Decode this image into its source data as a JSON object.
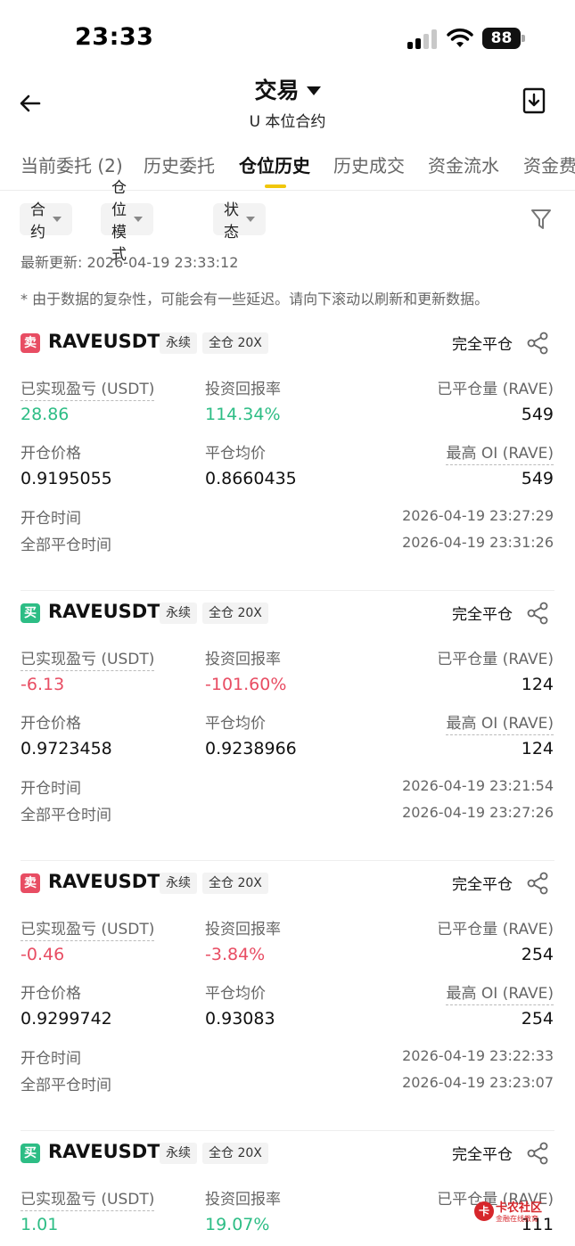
{
  "status_bar": {
    "time": "23:33",
    "battery": "88"
  },
  "header": {
    "title": "交易",
    "subtitle": "U 本位合约"
  },
  "tabs": [
    {
      "label": "当前委托 (2)",
      "active": false
    },
    {
      "label": "历史委托",
      "active": false
    },
    {
      "label": "仓位历史",
      "active": true
    },
    {
      "label": "历史成交",
      "active": false
    },
    {
      "label": "资金流水",
      "active": false
    },
    {
      "label": "资金费",
      "active": false
    }
  ],
  "filters": {
    "contract": "合约",
    "mode": "仓位模式",
    "status": "状态"
  },
  "last_updated": "最新更新: 2026-04-19 23:33:12",
  "note": "* 由于数据的复杂性，可能会有一些延迟。请向下滚动以刷新和更新数据。",
  "labels": {
    "realized_pnl": "已实现盈亏 (USDT)",
    "roi": "投资回报率",
    "closed_qty": "已平仓量 (RAVE)",
    "open_price": "开仓价格",
    "avg_close_price": "平仓均价",
    "max_oi": "最高 OI (RAVE)",
    "open_time": "开仓时间",
    "full_close_time": "全部平仓时间",
    "tag_perp": "永续",
    "tag_margin": "全仓 20X",
    "close_status": "完全平仓"
  },
  "positions": [
    {
      "side_label": "卖",
      "side": "sell",
      "symbol": "RAVEUSDT",
      "realized_pnl": "28.86",
      "roi": "114.34%",
      "trend": "pos",
      "closed_qty": "549",
      "open_price": "0.9195055",
      "avg_close_price": "0.8660435",
      "max_oi": "549",
      "open_time": "2026-04-19 23:27:29",
      "close_time": "2026-04-19 23:31:26"
    },
    {
      "side_label": "买",
      "side": "buy",
      "symbol": "RAVEUSDT",
      "realized_pnl": "-6.13",
      "roi": "-101.60%",
      "trend": "neg",
      "closed_qty": "124",
      "open_price": "0.9723458",
      "avg_close_price": "0.9238966",
      "max_oi": "124",
      "open_time": "2026-04-19 23:21:54",
      "close_time": "2026-04-19 23:27:26"
    },
    {
      "side_label": "卖",
      "side": "sell",
      "symbol": "RAVEUSDT",
      "realized_pnl": "-0.46",
      "roi": "-3.84%",
      "trend": "neg",
      "closed_qty": "254",
      "open_price": "0.9299742",
      "avg_close_price": "0.93083",
      "max_oi": "254",
      "open_time": "2026-04-19 23:22:33",
      "close_time": "2026-04-19 23:23:07"
    },
    {
      "side_label": "买",
      "side": "buy",
      "symbol": "RAVEUSDT",
      "realized_pnl": "1.01",
      "roi": "19.07%",
      "trend": "pos",
      "closed_qty": "111"
    }
  ],
  "watermark": {
    "name": "卡农社区",
    "tagline": "金融在线教育"
  },
  "colors": {
    "accent": "#f0c60a",
    "positive": "#2dbd85",
    "negative": "#e84d63"
  }
}
